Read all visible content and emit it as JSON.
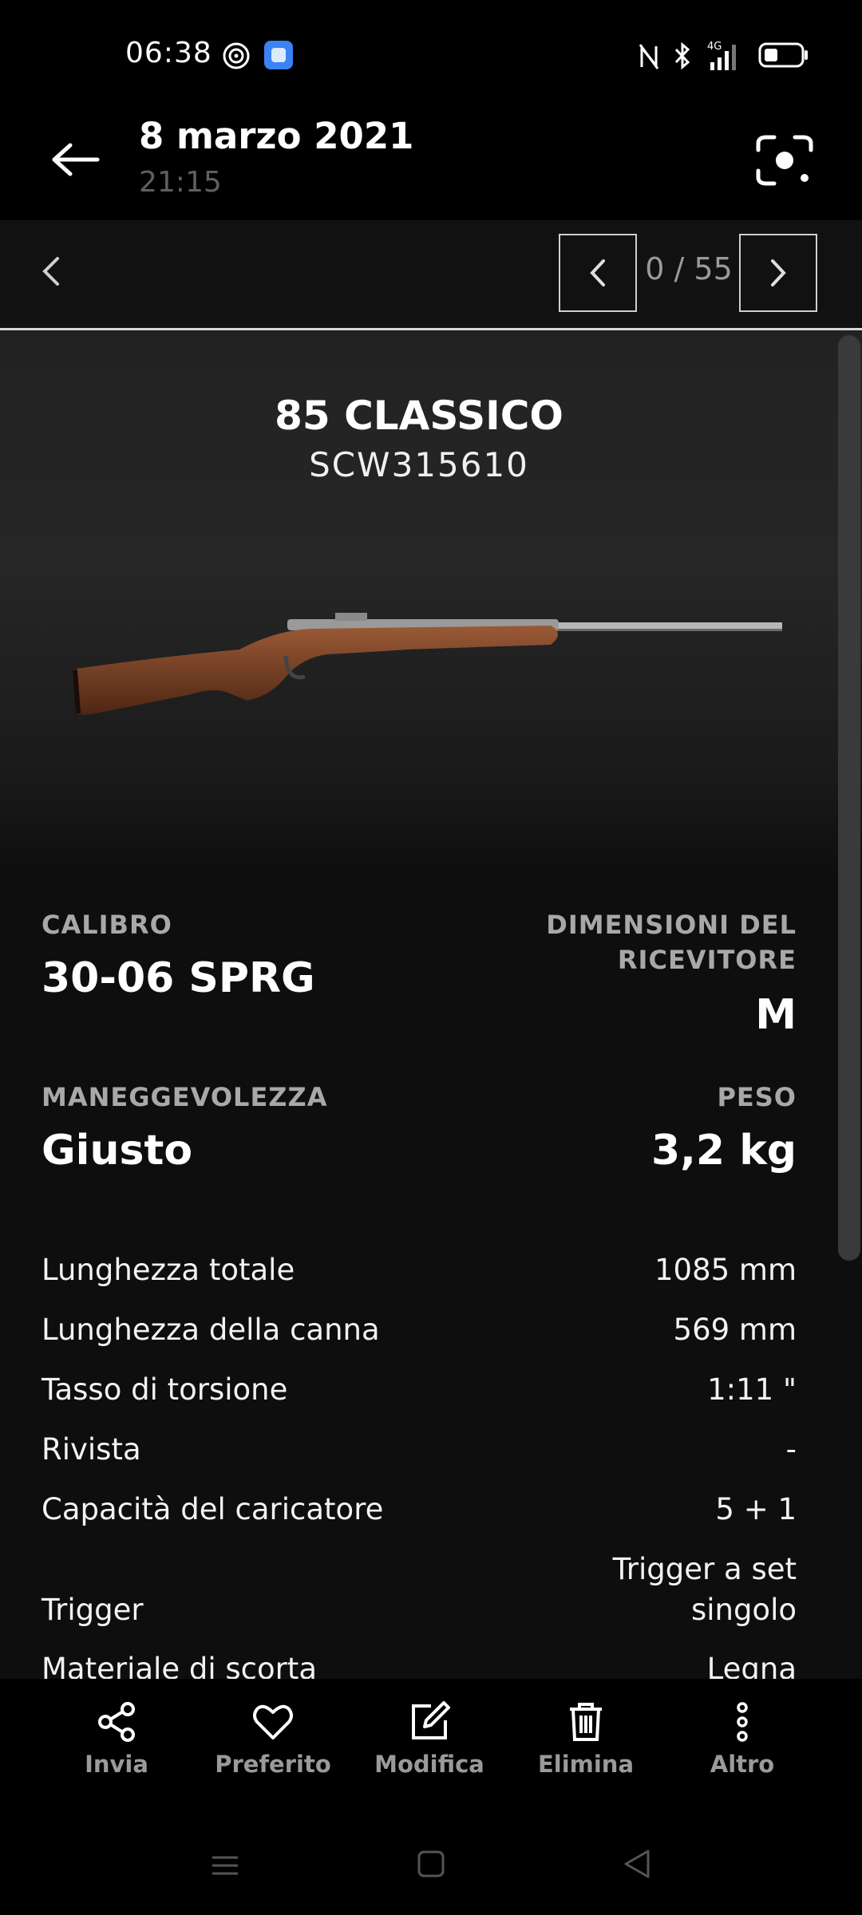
{
  "status_bar": {
    "time": "06:38",
    "network": "4G"
  },
  "header": {
    "date": "8 marzo 2021",
    "time": "21:15"
  },
  "pager": {
    "label": "0 / 55"
  },
  "product": {
    "name": "85 CLASSICO",
    "serial": "SCW315610"
  },
  "specs": {
    "calibro": {
      "label": "CALIBRO",
      "value": "30-06 SPRG"
    },
    "ricevitore": {
      "label_line1": "DIMENSIONI DEL",
      "label_line2": "RICEVITORE",
      "value": "M"
    },
    "maneggevolezza": {
      "label": "MANEGGEVOLEZZA",
      "value": "Giusto"
    },
    "peso": {
      "label": "PESO",
      "value": "3,2 kg"
    }
  },
  "details": [
    {
      "label": "Lunghezza totale",
      "value": "1085 mm"
    },
    {
      "label": "Lunghezza della canna",
      "value": "569 mm"
    },
    {
      "label": "Tasso di torsione",
      "value": "1:11 \""
    },
    {
      "label": "Rivista",
      "value": "-"
    },
    {
      "label": "Capacità del caricatore",
      "value": "5 + 1"
    },
    {
      "label": "Trigger",
      "value_line1": "Trigger a set",
      "value_line2": "singolo"
    },
    {
      "label": "Materiale di scorta",
      "value": "Legna"
    }
  ],
  "toolbar": {
    "share": "Invia",
    "favorite": "Preferito",
    "edit": "Modifica",
    "delete": "Elimina",
    "more": "Altro"
  },
  "icons": {
    "back": "arrow-left-icon",
    "lens": "google-lens-icon",
    "share": "share-icon",
    "favorite": "heart-icon",
    "edit": "edit-icon",
    "delete": "trash-icon",
    "more": "more-vertical-icon"
  }
}
